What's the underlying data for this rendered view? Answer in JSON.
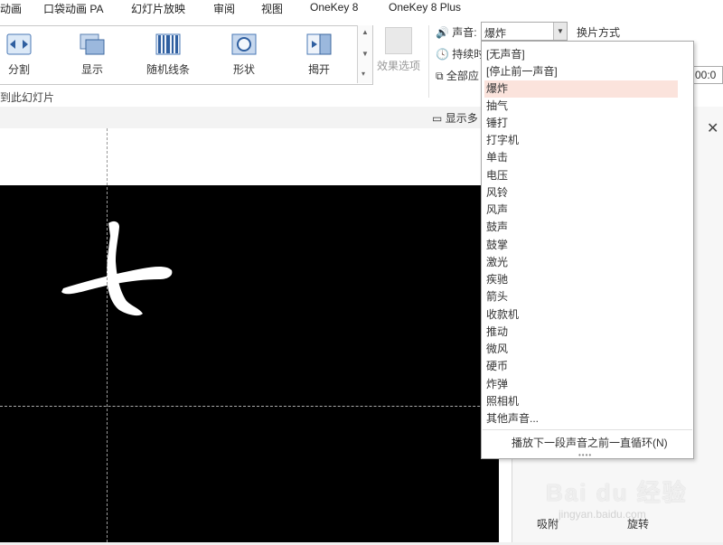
{
  "menubar": {
    "items": [
      "动画",
      "口袋动画 PA",
      "幻灯片放映",
      "审阅",
      "视图",
      "OneKey 8",
      "OneKey 8 Plus"
    ]
  },
  "ribbon": {
    "gallery": [
      {
        "label": "分割",
        "icon": "split-icon"
      },
      {
        "label": "显示",
        "icon": "reveal-icon"
      },
      {
        "label": "随机线条",
        "icon": "random-bars-icon"
      },
      {
        "label": "形状",
        "icon": "shape-icon"
      },
      {
        "label": "揭开",
        "icon": "uncover-icon"
      }
    ],
    "effect_options": "效果选项",
    "group_label": "到此幻灯片",
    "show_more": "显示多",
    "sound": {
      "label": "声音:",
      "value": "爆炸"
    },
    "switch_mode": "换片方式",
    "duration_label": "持续时",
    "apply_all": "全部应",
    "time_value": "00:0"
  },
  "dropdown": {
    "options": [
      "[无声音]",
      "[停止前一声音]",
      "爆炸",
      "抽气",
      "锤打",
      "打字机",
      "单击",
      "电压",
      "风铃",
      "风声",
      "鼓声",
      "鼓掌",
      "激光",
      "疾驰",
      "箭头",
      "收款机",
      "推动",
      "微风",
      "硬币",
      "炸弹",
      "照相机",
      "其他声音..."
    ],
    "selected_index": 2,
    "loop_option": "播放下一段声音之前一直循环(N)"
  },
  "right_pane": {
    "snap_label": "吸附",
    "rotate_label": "旋转"
  },
  "watermark": {
    "text": "Bai du 经验",
    "url": "jingyan.baidu.com"
  },
  "colors": {
    "selected_option_bg": "#fbe3dc",
    "slide_bg": "#000000"
  }
}
